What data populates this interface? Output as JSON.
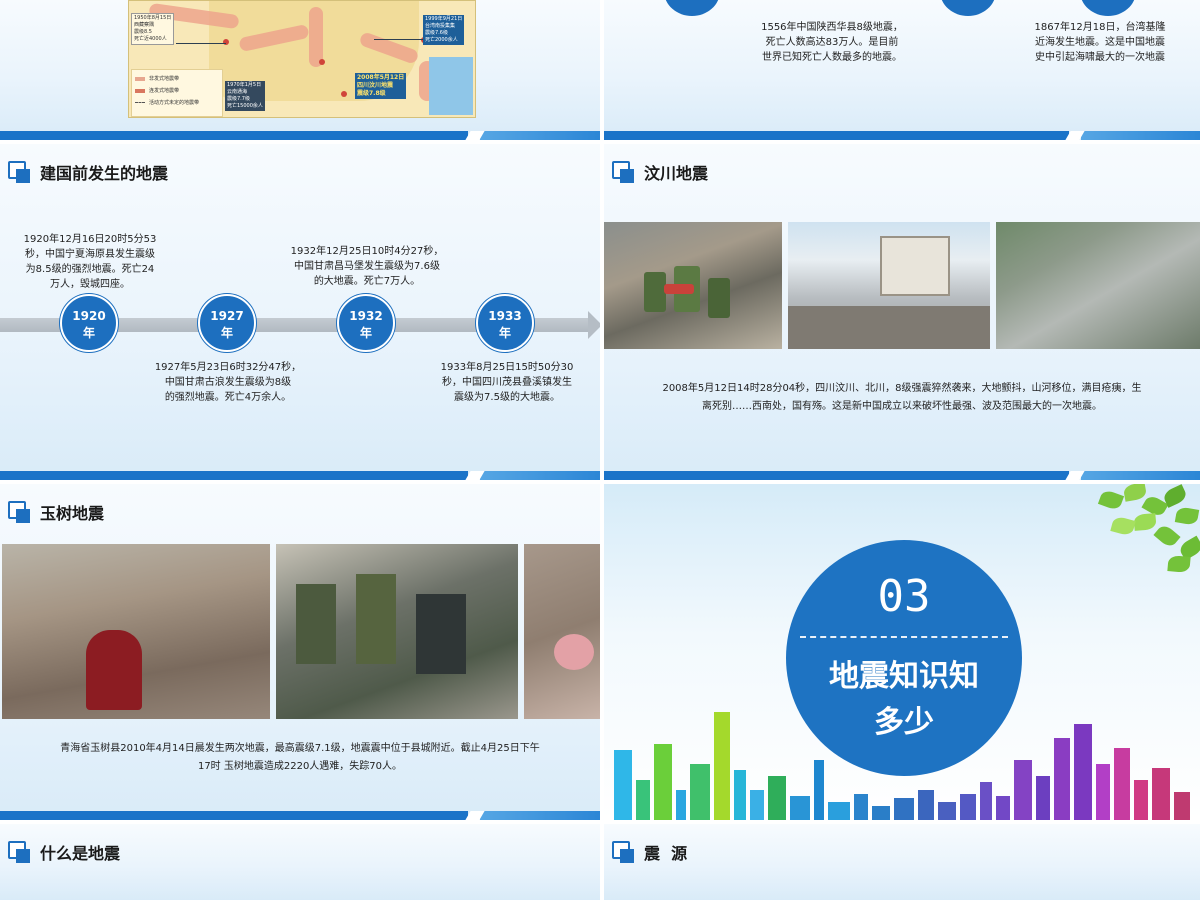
{
  "slide_map": {
    "labels": {
      "l1950": "1950年8月15日\n西藏察隅\n震级8.5\n死亡近4000人",
      "l1999": "1999年9月21日\n台湾南投集集\n震级7.6级\n死亡2000余人",
      "l1970": "1970年1月5日\n云南通海\n震级7.7级\n死亡15000余人",
      "l2008": "2008年5月12日\n四川汶川地震\n震级7.8级"
    },
    "legend": {
      "item1": "非发式地震带",
      "item2": "连发式地震带",
      "item3": "活动方式未定的地震带"
    }
  },
  "slide_top_right": {
    "left_text": "1556年中国陕西华县8级地震，\n死亡人数高达83万人。是目前\n世界已知死亡人数最多的地震。",
    "right_text": "1867年12月18日，台湾基隆\n近海发生地震。这是中国地震\n史中引起海啸最大的一次地震"
  },
  "slide_before": {
    "title": "建国前发生的地震",
    "nodes": [
      {
        "year": "1920",
        "suffix": "年"
      },
      {
        "year": "1927",
        "suffix": "年"
      },
      {
        "year": "1932",
        "suffix": "年"
      },
      {
        "year": "1933",
        "suffix": "年"
      }
    ],
    "texts": {
      "t1920": "1920年12月16日20时5分53\n秒，中国宁夏海原县发生震级\n为8.5级的强烈地震。死亡24\n万人，毁城四座。",
      "t1927": "1927年5月23日6时32分47秒，\n中国甘肃古浪发生震级为8级\n的强烈地震。死亡4万余人。",
      "t1932": "1932年12月25日10时4分27秒，\n中国甘肃昌马堡发生震级为7.6级\n的大地震。死亡7万人。",
      "t1933": "1933年8月25日15时50分30\n秒，中国四川茂县叠溪镇发生\n震级为7.5级的大地震。"
    }
  },
  "slide_wenchuan": {
    "title": "汶川地震",
    "caption": "2008年5月12日14时28分04秒，四川汶川、北川，8级强震猝然袭来，大地颤抖，山河移位，满目疮痍，生\n离死别……西南处，国有殇。这是新中国成立以来破坏性最强、波及范围最大的一次地震。"
  },
  "slide_yushu": {
    "title": "玉树地震",
    "caption": "青海省玉树县2010年4月14日晨发生两次地震，最高震级7.1级，地震震中位于县城附近。截止4月25日下午\n17时 玉树地震造成2220人遇难，失踪70人。"
  },
  "slide_section": {
    "number": "03",
    "title_line1": "地震知识知",
    "title_line2": "多少"
  },
  "slide_what": {
    "title": "什么是地震"
  },
  "slide_source": {
    "title": "震  源"
  },
  "colors": {
    "accent": "#1d6fbf",
    "bar": "#1a73c8",
    "timeline": "#b5bdc5"
  }
}
